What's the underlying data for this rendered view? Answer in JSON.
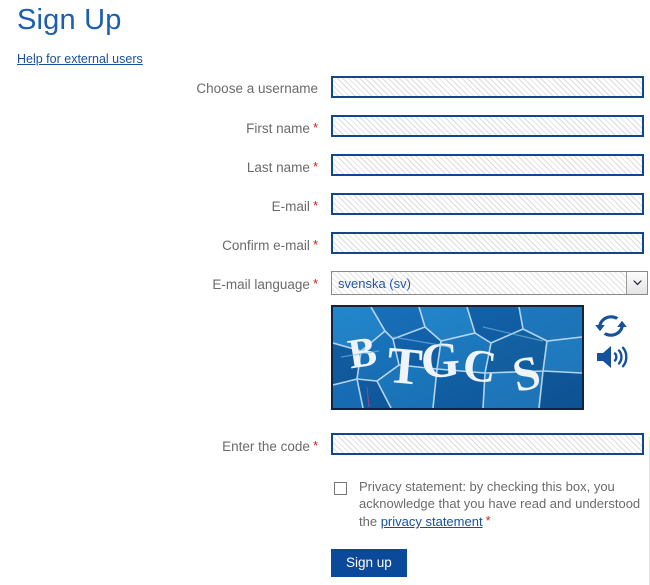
{
  "page": {
    "title": "Sign Up",
    "help_link": "Help for external users"
  },
  "form": {
    "fields": [
      {
        "label": "Choose a username",
        "required": false,
        "value": "",
        "type": "text"
      },
      {
        "label": "First name",
        "required": true,
        "value": "",
        "type": "text"
      },
      {
        "label": "Last name",
        "required": true,
        "value": "",
        "type": "text"
      },
      {
        "label": "E-mail",
        "required": true,
        "value": "",
        "type": "text"
      },
      {
        "label": "Confirm e-mail",
        "required": true,
        "value": "",
        "type": "text"
      },
      {
        "label": "E-mail language",
        "required": true,
        "value": "svenska (sv)",
        "type": "select"
      }
    ],
    "code_field": {
      "label": "Enter the code",
      "required": true,
      "value": ""
    },
    "required_marker": "*"
  },
  "captcha": {
    "code_text": "BTGCS",
    "refresh_icon": "refresh-icon",
    "audio_icon": "speaker-icon",
    "background_color": "#1266b0",
    "letter_color": "#f0f4f8"
  },
  "privacy": {
    "text_before": "Privacy statement: by checking this box, you acknowledge that you have read and understood the ",
    "link_text": "privacy statement",
    "required_marker": "*",
    "checked": false
  },
  "submit": {
    "label": "Sign up"
  },
  "colors": {
    "title_blue": "#1b5fb0",
    "link_blue": "#1b4f9c",
    "input_border": "#11478f",
    "label_gray": "#6b6b6b",
    "required_red": "#cc2222",
    "button_blue": "#0b4a9b"
  }
}
